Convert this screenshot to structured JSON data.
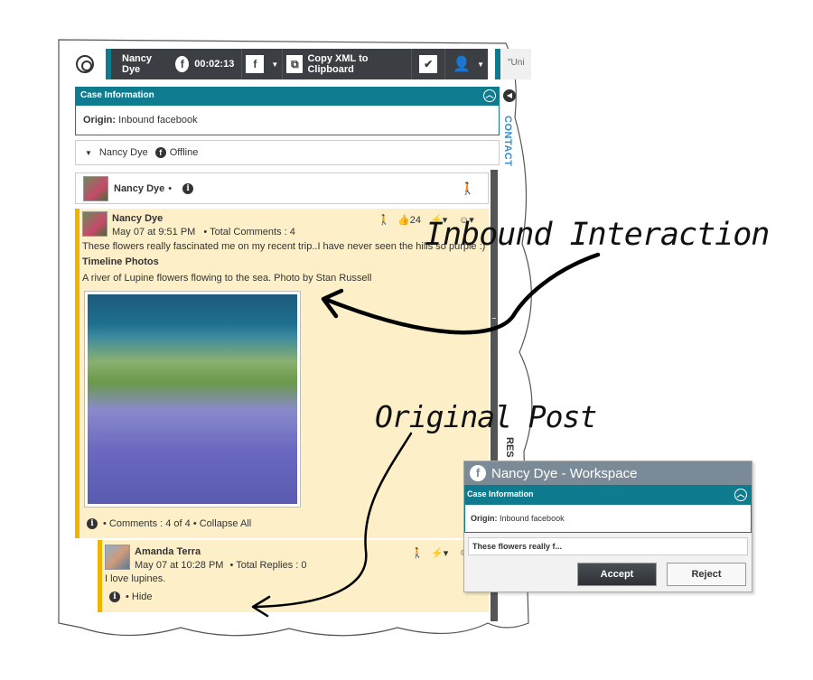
{
  "toolbar": {
    "contact_name": "Nancy Dye",
    "timer": "00:02:13",
    "copy_label": "Copy XML to Clipboard",
    "right_tab_text": "\"Uni"
  },
  "case": {
    "header": "Case Information",
    "origin_label": "Origin:",
    "origin_value": "Inbound facebook"
  },
  "side": {
    "contact_tab": "CONTACT",
    "res_tab": "RES"
  },
  "contact_row": {
    "name": "Nancy Dye",
    "status": "Offline"
  },
  "header_card": {
    "name": "Nancy Dye",
    "dot": "•"
  },
  "post": {
    "author": "Nancy Dye",
    "date": "May 07 at 9:51 PM",
    "comments_meta": "• Total Comments :  4",
    "likes": "24",
    "text": "These flowers really fascinated me on my recent trip..I have never seen the hills so purple :)",
    "album_title": "Timeline Photos",
    "caption": "A river of Lupine flowers flowing to the sea. Photo by Stan Russell",
    "footer": "• Comments :  4 of 4  •  Collapse All"
  },
  "reply": {
    "author": "Amanda Terra",
    "date": "May 07 at 10:28 PM",
    "meta": "• Total Replies :  0",
    "text": "I love lupines.",
    "footer": "•  Hide"
  },
  "annotations": {
    "inbound": "Inbound Interaction",
    "original": "Original Post"
  },
  "workspace": {
    "title": "Nancy Dye - Workspace",
    "case_header": "Case Information",
    "origin_label": "Origin:",
    "origin_value": "Inbound facebook",
    "message": "These flowers really f...",
    "accept": "Accept",
    "reject": "Reject"
  },
  "colors": {
    "teal": "#0f7b8e",
    "dark": "#3b3f43",
    "post_bg": "#fdf0c8",
    "accent_bar": "#f0b400"
  }
}
